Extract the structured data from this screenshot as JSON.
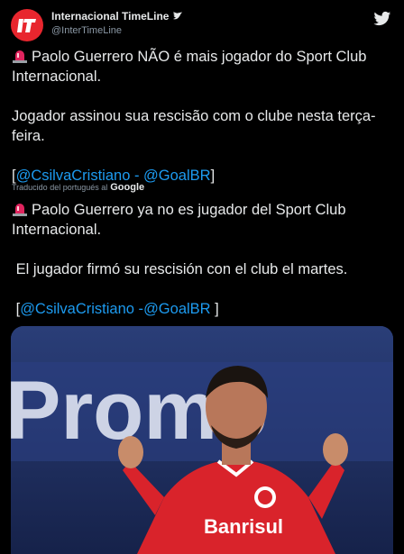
{
  "header": {
    "display_name": "Internacional TimeLine",
    "handle": "@InterTimeLine",
    "avatar_text": "It"
  },
  "original": {
    "line1": "Paolo Guerrero NÃO é mais jogador do Sport Club Internacional.",
    "line2": "Jogador assinou sua rescisão com o clube nesta terça-feira.",
    "mention1": "@CsilvaCristiano",
    "sep": " - ",
    "mention2": "@GoalBR"
  },
  "translation_note": {
    "label": "Traducido del portugués al",
    "provider": "Google"
  },
  "translated": {
    "line1": "Paolo Guerrero ya no es jugador del Sport Club Internacional.",
    "line2": "El jugador firmó su rescisión con el club el martes.",
    "mention1": "@CsilvaCristiano",
    "sep": " -",
    "mention2": "@GoalBR"
  },
  "media": {
    "banner_text": "Promo",
    "jersey_sponsor": "Banrisul"
  },
  "colors": {
    "brand_red": "#e8262e",
    "link": "#1d9bf0",
    "background": "#000000"
  }
}
